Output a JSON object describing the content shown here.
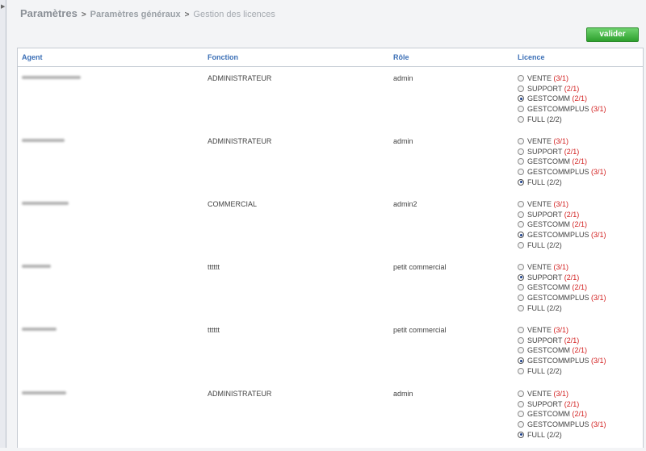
{
  "breadcrumb": {
    "root": "Paramètres",
    "section": "Paramètres généraux",
    "current": "Gestion des licences",
    "separator": ">"
  },
  "actions": {
    "validate_label": "valider"
  },
  "table": {
    "headers": {
      "agent": "Agent",
      "fonction": "Fonction",
      "role": "Rôle",
      "licence": "Licence"
    },
    "rows": [
      {
        "fonction": "ADMINISTRATEUR",
        "role": "admin",
        "licences": [
          {
            "label": "VENTE",
            "count": "(3/1)",
            "selected": false,
            "over": true
          },
          {
            "label": "SUPPORT",
            "count": "(2/1)",
            "selected": false,
            "over": true
          },
          {
            "label": "GESTCOMM",
            "count": "(2/1)",
            "selected": true,
            "over": true
          },
          {
            "label": "GESTCOMMPLUS",
            "count": "(3/1)",
            "selected": false,
            "over": true
          },
          {
            "label": "FULL",
            "count": "(2/2)",
            "selected": false,
            "over": false
          }
        ]
      },
      {
        "fonction": "ADMINISTRATEUR",
        "role": "admin",
        "licences": [
          {
            "label": "VENTE",
            "count": "(3/1)",
            "selected": false,
            "over": true
          },
          {
            "label": "SUPPORT",
            "count": "(2/1)",
            "selected": false,
            "over": true
          },
          {
            "label": "GESTCOMM",
            "count": "(2/1)",
            "selected": false,
            "over": true
          },
          {
            "label": "GESTCOMMPLUS",
            "count": "(3/1)",
            "selected": false,
            "over": true
          },
          {
            "label": "FULL",
            "count": "(2/2)",
            "selected": true,
            "over": false
          }
        ]
      },
      {
        "fonction": "COMMERCIAL",
        "role": "admin2",
        "licences": [
          {
            "label": "VENTE",
            "count": "(3/1)",
            "selected": false,
            "over": true
          },
          {
            "label": "SUPPORT",
            "count": "(2/1)",
            "selected": false,
            "over": true
          },
          {
            "label": "GESTCOMM",
            "count": "(2/1)",
            "selected": false,
            "over": true
          },
          {
            "label": "GESTCOMMPLUS",
            "count": "(3/1)",
            "selected": true,
            "over": true
          },
          {
            "label": "FULL",
            "count": "(2/2)",
            "selected": false,
            "over": false
          }
        ]
      },
      {
        "fonction": "tttttt",
        "role": "petit commercial",
        "licences": [
          {
            "label": "VENTE",
            "count": "(3/1)",
            "selected": false,
            "over": true
          },
          {
            "label": "SUPPORT",
            "count": "(2/1)",
            "selected": true,
            "over": true
          },
          {
            "label": "GESTCOMM",
            "count": "(2/1)",
            "selected": false,
            "over": true
          },
          {
            "label": "GESTCOMMPLUS",
            "count": "(3/1)",
            "selected": false,
            "over": true
          },
          {
            "label": "FULL",
            "count": "(2/2)",
            "selected": false,
            "over": false
          }
        ]
      },
      {
        "fonction": "tttttt",
        "role": "petit commercial",
        "licences": [
          {
            "label": "VENTE",
            "count": "(3/1)",
            "selected": false,
            "over": true
          },
          {
            "label": "SUPPORT",
            "count": "(2/1)",
            "selected": false,
            "over": true
          },
          {
            "label": "GESTCOMM",
            "count": "(2/1)",
            "selected": false,
            "over": true
          },
          {
            "label": "GESTCOMMPLUS",
            "count": "(3/1)",
            "selected": true,
            "over": true
          },
          {
            "label": "FULL",
            "count": "(2/2)",
            "selected": false,
            "over": false
          }
        ]
      },
      {
        "fonction": "ADMINISTRATEUR",
        "role": "admin",
        "licences": [
          {
            "label": "VENTE",
            "count": "(3/1)",
            "selected": false,
            "over": true
          },
          {
            "label": "SUPPORT",
            "count": "(2/1)",
            "selected": false,
            "over": true
          },
          {
            "label": "GESTCOMM",
            "count": "(2/1)",
            "selected": false,
            "over": true
          },
          {
            "label": "GESTCOMMPLUS",
            "count": "(3/1)",
            "selected": false,
            "over": true
          },
          {
            "label": "FULL",
            "count": "(2/2)",
            "selected": true,
            "over": false
          }
        ]
      }
    ]
  },
  "colors": {
    "header_text": "#3b6fb6",
    "count_over": "#d21e1e",
    "button_green": "#2ea02e"
  }
}
